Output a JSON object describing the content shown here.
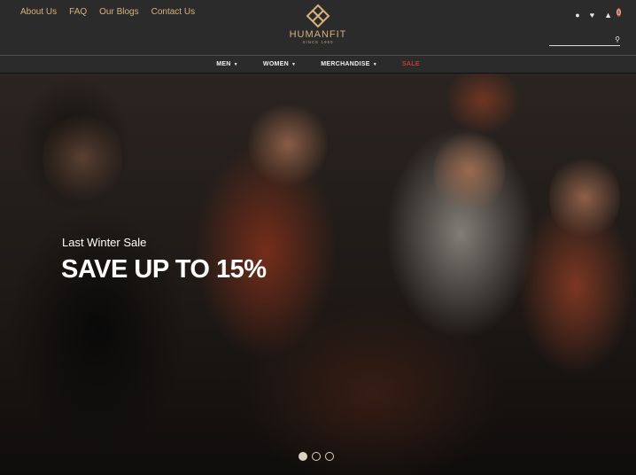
{
  "top_links": [
    "About Us",
    "FAQ",
    "Our Blogs",
    "Contact Us"
  ],
  "logo": {
    "name": "HUMANFIT",
    "since": "SINCE 1980"
  },
  "cart_count": "0",
  "search": {
    "placeholder": ""
  },
  "nav": {
    "men": "MEN",
    "women": "WOMEN",
    "merchandise": "MERCHANDISE",
    "sale": "SALE"
  },
  "hero": {
    "subtitle": "Last Winter Sale",
    "title": "SAVE UP TO 15%",
    "slide_count": 3,
    "active_slide": 1
  },
  "colors": {
    "accent": "#d7b27a",
    "sale": "#c83b2f",
    "bar": "#2b2b2b"
  },
  "icons": [
    "user-icon",
    "heart-icon",
    "cart-icon",
    "search-icon"
  ]
}
